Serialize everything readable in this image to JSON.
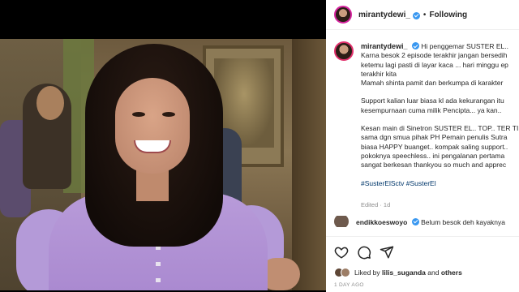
{
  "post": {
    "username": "mirantydewi_",
    "follow_label": "Following",
    "separator": "•",
    "caption_lines": [
      "Hi penggemar SUSTER EL..",
      "Karna besok 2 episode terakhir jangan bersedih",
      "ketemu lagi pasti di layar kaca ... hari minggu ep",
      "terakhir kita",
      "Mamah shinta pamit dan berkumpa di karakter",
      "",
      "Support kalian luar biasa kl ada kekurangan itu",
      "kesempurnaan cuma milik Pencipta... ya kan..",
      "",
      "Kesan main di Sinetron SUSTER EL.. TOP.. TER TI",
      "sama dgn smua pihak PH Pemain penulis Sutra",
      "biasa HAPPY buanget.. kompak saling support..",
      "pokoknya speechless.. ini pengalanan pertama",
      "sangat berkesan thankyou so much and apprec"
    ],
    "hashtags": "#SusterElSctv #SusterEl",
    "edited": "Edited · 1d",
    "comment": {
      "username": "endikkoeswoyo",
      "text": "Belum besok deh kayaknya"
    },
    "likes": {
      "prefix": "Liked by",
      "user": "lilis_suganda",
      "and": "and",
      "others": "others"
    },
    "time_ago": "1 DAY AGO"
  },
  "icons": [
    "heart-icon",
    "comment-icon",
    "share-icon",
    "verified-icon"
  ],
  "colors": {
    "verified_blue": "#3897f0",
    "hashtag": "#00376b",
    "muted": "#8e8e8e"
  }
}
